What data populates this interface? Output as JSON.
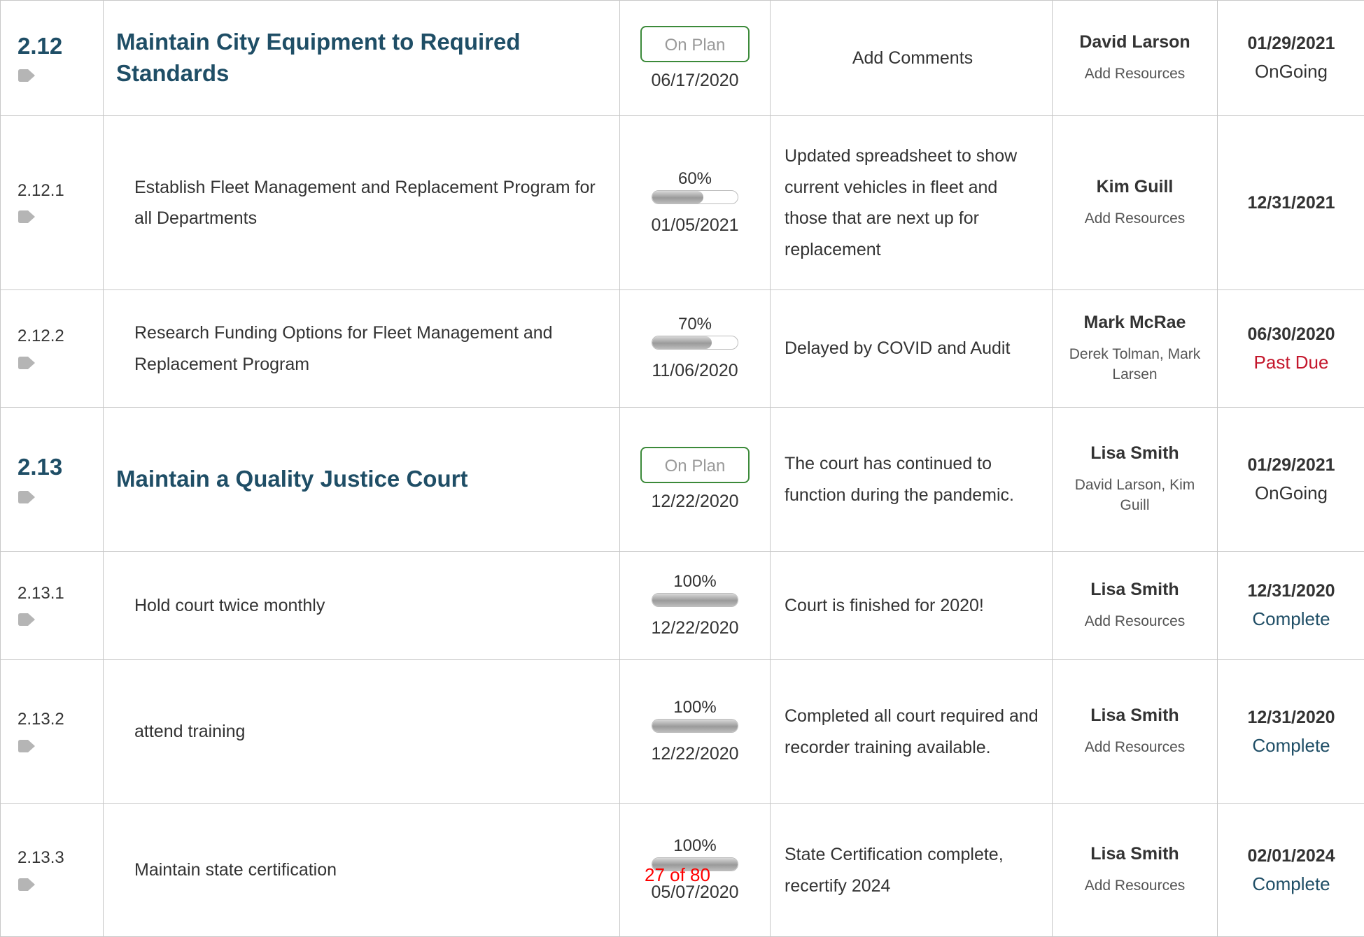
{
  "rows": [
    {
      "number": "2.12",
      "title": "Maintain City Equipment to Required Standards",
      "status_badge": "On Plan",
      "status_date": "06/17/2020",
      "comment": "Add Comments",
      "owner": "David Larson",
      "resources": "Add Resources",
      "due_date": "01/29/2021",
      "due_status": "OnGoing"
    },
    {
      "number": "2.12.1",
      "title": "Establish Fleet Management and Replacement Program for all Departments",
      "progress": "60%",
      "progress_value": 0.6,
      "status_date": "01/05/2021",
      "comment": "Updated spreadsheet to show current vehicles in fleet and those that are next up for replacement",
      "owner": "Kim Guill",
      "resources": "Add Resources",
      "due_date": "12/31/2021",
      "due_status": ""
    },
    {
      "number": "2.12.2",
      "title": "Research Funding Options for Fleet Management and Replacement Program",
      "progress": "70%",
      "progress_value": 0.7,
      "status_date": "11/06/2020",
      "comment": "Delayed by COVID and Audit",
      "owner": "Mark McRae",
      "resources": "Derek Tolman, Mark Larsen",
      "due_date": "06/30/2020",
      "due_status": "Past Due"
    },
    {
      "number": "2.13",
      "title": "Maintain a Quality Justice Court",
      "status_badge": "On Plan",
      "status_date": "12/22/2020",
      "comment": "The court has continued to function during the pandemic.",
      "owner": "Lisa Smith",
      "resources": "David Larson, Kim Guill",
      "due_date": "01/29/2021",
      "due_status": "OnGoing"
    },
    {
      "number": "2.13.1",
      "title": "Hold court twice monthly",
      "progress": "100%",
      "progress_value": 1.0,
      "status_date": "12/22/2020",
      "comment": "Court is finished for 2020!",
      "owner": "Lisa Smith",
      "resources": "Add Resources",
      "due_date": "12/31/2020",
      "due_status": "Complete"
    },
    {
      "number": "2.13.2",
      "title": "attend training",
      "progress": "100%",
      "progress_value": 1.0,
      "status_date": "12/22/2020",
      "comment": "Completed all court required and recorder training available.",
      "owner": "Lisa Smith",
      "resources": "Add Resources",
      "due_date": "12/31/2020",
      "due_status": "Complete"
    },
    {
      "number": "2.13.3",
      "title": "Maintain state certification",
      "progress": "100%",
      "progress_value": 1.0,
      "status_date": "05/07/2020",
      "comment": "State Certification complete, recertify 2024",
      "owner": "Lisa Smith",
      "resources": "Add Resources",
      "due_date": "02/01/2024",
      "due_status": "Complete"
    }
  ],
  "page_indicator": "27 of 80",
  "colors": {
    "goal_text": "#1f4e66",
    "badge_border": "#3c8a3a",
    "past_due": "#c4172c",
    "complete": "#1f4e66",
    "page_indicator": "#ff0000"
  },
  "icons": {
    "row_tag": "tag-icon"
  }
}
